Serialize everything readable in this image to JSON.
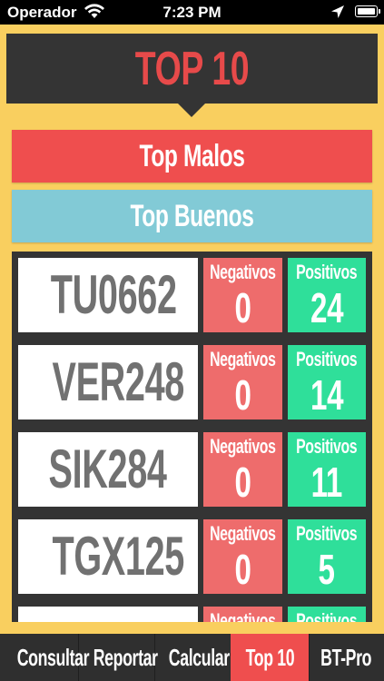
{
  "status_bar": {
    "carrier": "Operador",
    "time": "7:23 PM",
    "wifi_icon": "wifi-icon",
    "location_icon": "location-arrow-icon",
    "battery_icon": "battery-icon"
  },
  "header": {
    "title": "TOP 10"
  },
  "buttons": {
    "top_malos": "Top Malos",
    "top_buenos": "Top Buenos"
  },
  "list": {
    "negative_label": "Negativos",
    "positive_label": "Positivos",
    "rows": [
      {
        "plate": "TU0662",
        "negativos": "0",
        "positivos": "24"
      },
      {
        "plate": "VER248",
        "negativos": "0",
        "positivos": "14"
      },
      {
        "plate": "SIK284",
        "negativos": "0",
        "positivos": "11"
      },
      {
        "plate": "TGX125",
        "negativos": "0",
        "positivos": "5"
      }
    ]
  },
  "tabs": [
    {
      "label": "Consultar",
      "active": false
    },
    {
      "label": "Reportar",
      "active": false
    },
    {
      "label": "Calcular",
      "active": false
    },
    {
      "label": "Top 10",
      "active": true
    },
    {
      "label": "BT-Pro",
      "active": false
    }
  ],
  "colors": {
    "background": "#f9cf5f",
    "header": "#343434",
    "title_red": "#e74a4a",
    "malos_red": "#ef4e4e",
    "buenos_blue": "#82cad6",
    "negative_red": "#ee6c6c",
    "positive_green": "#2fdf9a"
  }
}
